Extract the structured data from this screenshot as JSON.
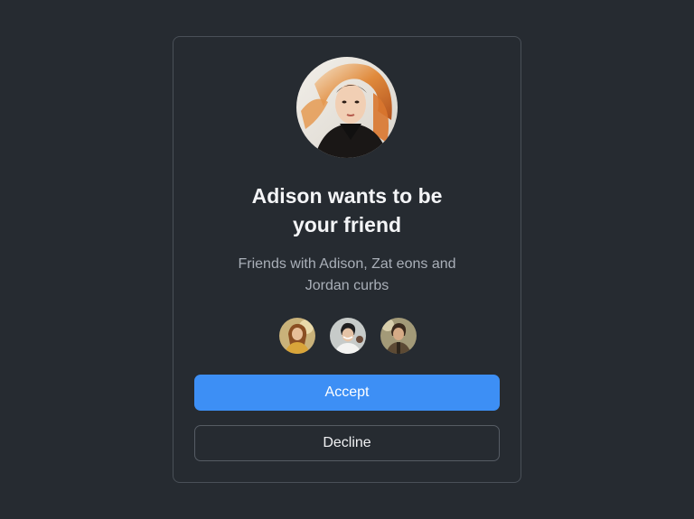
{
  "card": {
    "title_line1": "Adison wants to be",
    "title_line2": "your friend",
    "subtitle_line1": "Friends with Adison, Zat eons and",
    "subtitle_line2": "Jordan curbs"
  },
  "actions": {
    "accept_label": "Accept",
    "decline_label": "Decline"
  },
  "colors": {
    "background": "#262b31",
    "card_border": "#4a5058",
    "accent": "#3d8ff5",
    "title_text": "#f4f5f7",
    "subtitle_text": "#a9afb8"
  }
}
